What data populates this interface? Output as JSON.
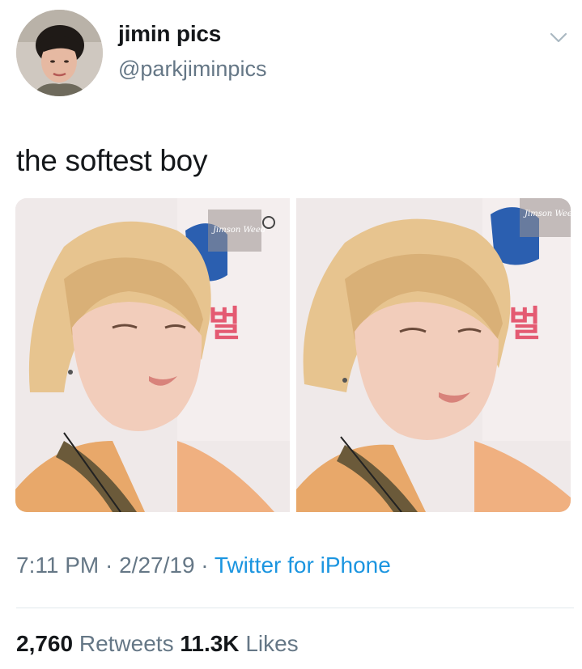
{
  "user": {
    "display_name": "jimin pics",
    "handle": "@parkjiminpics"
  },
  "tweet": {
    "text": "the softest boy",
    "time": "7:11 PM",
    "separator": "·",
    "date": "2/27/19",
    "source": "Twitter for iPhone"
  },
  "media": {
    "watermark": "Jimson Weed",
    "sign_text": "벌"
  },
  "stats": {
    "retweets_count": "2,760",
    "retweets_label": "Retweets",
    "likes_count": "11.3K",
    "likes_label": "Likes"
  },
  "icons": {
    "menu": "chevron-down-icon"
  },
  "colors": {
    "link": "#1b95e0",
    "secondary_text": "#657786",
    "primary_text": "#14171a",
    "divider": "#e1e8ed"
  }
}
